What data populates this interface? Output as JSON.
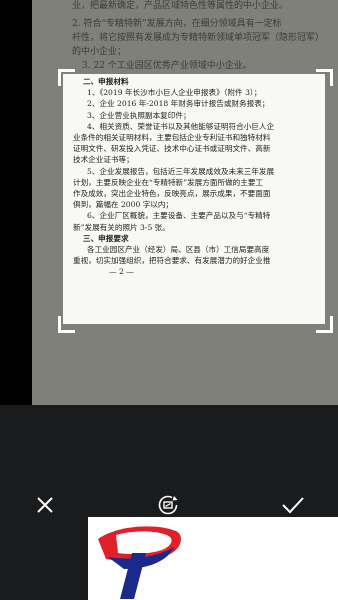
{
  "background_text": [
    "业，把最新确定，产品区域特色性等属性的中小企业。",
    "2. 符合“专精特新”发展方向，在细分领域具有一定标",
    "杆性，将它按照有发展成为专精特新领域单项冠军（隐形冠军）",
    "的中小企业；",
    "3. 22 个工业园区优秀产业领域中小企业。"
  ],
  "document": {
    "section2_title": "二、申报材料",
    "items": [
      "1、《2019 年长沙市小巨人企业申报表》（附件 3）；",
      "2、企业 2016 年-2018 年财务审计报告或财务报表；",
      "3、企业营业执照副本复印件；",
      "4、相关资质、荣誉证书以及其他能够证明符合小巨人企",
      "业条件的相关证明材料，主要包括企业专利证书和独特材料",
      "证明文件、研发投入凭证、技术中心证书或证明文件、高新",
      "技术企业证书等；",
      "5、企业发展报告，包括近三年发展成效及未来三年发展",
      "计划，主要反映企业在“专精特新”发展方面所做的主要工",
      "作及成效，突出企业特色，反映亮点，展示成果，不要面面",
      "俱到，篇幅在 2000 字以内；",
      "6、企业厂区概貌，主要设备、主要产品以及与“专精特",
      "新”发展有关的照片 3-5 张。"
    ],
    "section3_title": "三、申报要求",
    "requirement_lines": [
      "各工业园区产业（经发）局、区县（市）工信局要高度",
      "重视，切实加强组织，把符合要求、有发展潜力的好企业推"
    ],
    "page_mark": "— 2 —"
  },
  "toolbar": {
    "cancel_icon": "close-icon",
    "rotate_icon": "rotate-icon",
    "confirm_icon": "check-icon"
  },
  "colors": {
    "logo_blue": "#1a2a8c",
    "logo_red": "#e0202a"
  }
}
